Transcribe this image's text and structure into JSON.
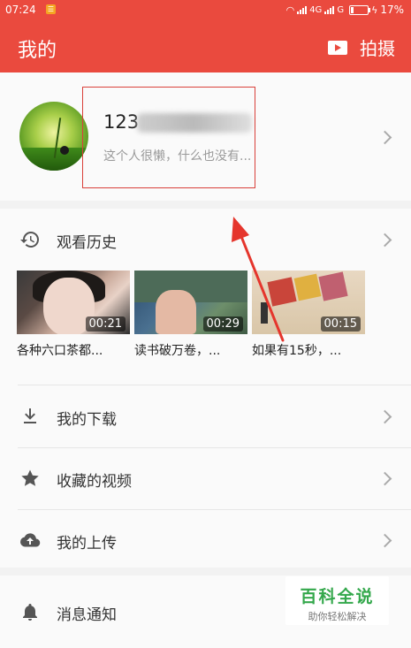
{
  "status": {
    "time": "07:24",
    "network": "4G",
    "network2": "G",
    "battery": "17%",
    "battery_level": 0.17
  },
  "appbar": {
    "title": "我的",
    "action": "拍摄"
  },
  "profile": {
    "username": "123",
    "signature": "这个人很懒，什么也没有..."
  },
  "history": {
    "label": "观看历史",
    "videos": [
      {
        "duration": "00:21",
        "caption": "各种六口茶都..."
      },
      {
        "duration": "00:29",
        "caption": "读书破万卷，..."
      },
      {
        "duration": "00:15",
        "caption": "如果有15秒，..."
      }
    ]
  },
  "menu": {
    "downloads": "我的下载",
    "favorites": "收藏的视频",
    "uploads": "我的上传",
    "notifications": "消息通知"
  },
  "watermark": {
    "title": "百科全说",
    "subtitle": "助你轻松解决"
  },
  "icons": {
    "history": "history-icon",
    "download": "download-icon",
    "favorite": "star-icon",
    "upload": "cloud-upload-icon",
    "notification": "bell-icon",
    "camera": "video-camera-icon"
  },
  "colors": {
    "accent": "#ea4a3e",
    "annotation": "#d9403a"
  }
}
